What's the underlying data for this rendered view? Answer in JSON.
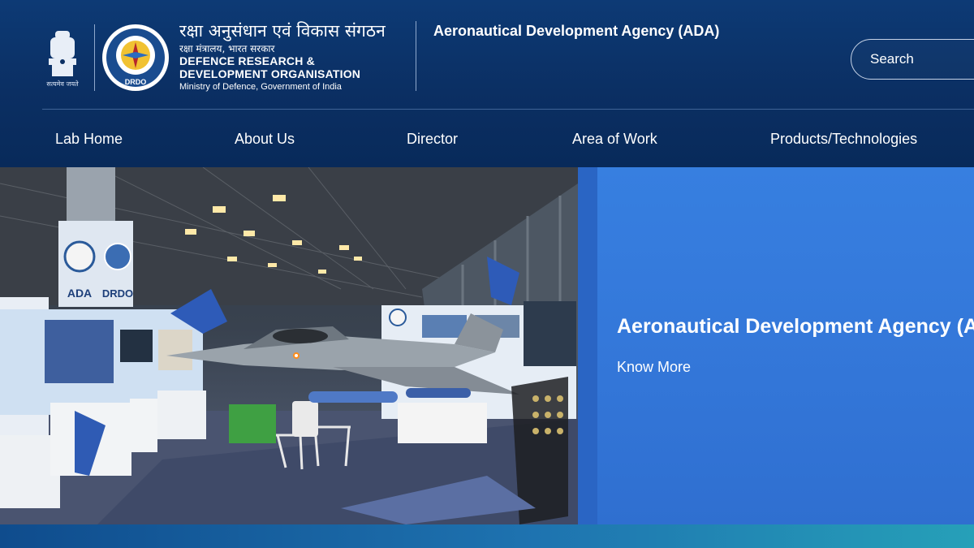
{
  "header": {
    "emblem_icon": "state-emblem-icon",
    "emblem_motto": "सत्यमेव जयते",
    "drdo_logo_icon": "drdo-logo-icon",
    "drdo_logo_text": "DRDO",
    "org_name_hindi": "रक्षा अनुसंधान एवं विकास संगठन",
    "org_ministry_hindi": "रक्षा मंत्रालय, भारत सरकार",
    "org_name_line1": "DEFENCE RESEARCH &",
    "org_name_line2": "DEVELOPMENT ORGANISATION",
    "org_ministry": "Ministry of Defence, Government of India",
    "lab_title": "Aeronautical Development Agency (ADA)",
    "search_placeholder": "Search"
  },
  "nav": {
    "items": [
      {
        "label": "Lab Home"
      },
      {
        "label": "About Us"
      },
      {
        "label": "Director"
      },
      {
        "label": "Area of Work"
      },
      {
        "label": "Products/Technologies"
      }
    ]
  },
  "hero": {
    "image_signage": [
      "ADA",
      "DRDO"
    ],
    "title": "Aeronautical Development Agency (ADA)",
    "link": "Know More"
  },
  "colors": {
    "header_bg": "#0b2f63",
    "hero_panel": "#377fe0",
    "text": "#ffffff"
  }
}
